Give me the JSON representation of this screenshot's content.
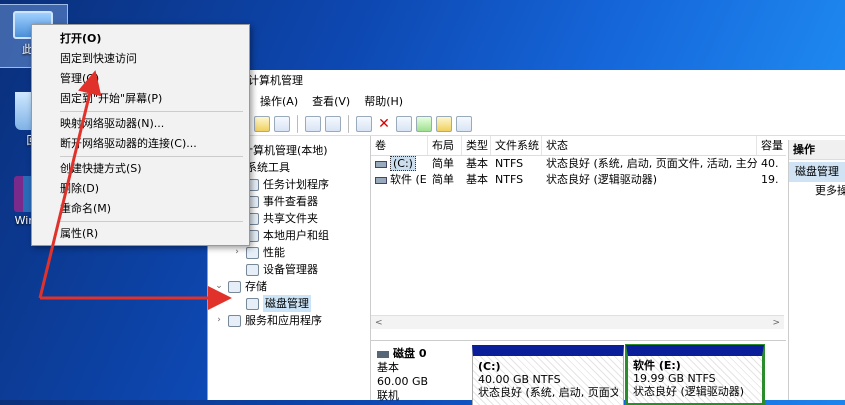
{
  "desktop": {
    "icons": [
      {
        "label": "此电",
        "icon": "this-pc-icon"
      },
      {
        "label": "回",
        "icon": "recycle-bin-icon"
      },
      {
        "label": "Win10",
        "icon": "winrar-icon"
      }
    ]
  },
  "context_menu": {
    "items": [
      "打开(O)",
      "固定到快速访问",
      "管理(G)",
      "固定到\"开始\"屏幕(P)",
      "映射网络驱动器(N)...",
      "断开网络驱动器的连接(C)...",
      "创建快捷方式(S)",
      "删除(D)",
      "重命名(M)",
      "属性(R)"
    ]
  },
  "window": {
    "title": "计算机管理",
    "menu": [
      "操作(A)",
      "查看(V)",
      "帮助(H)"
    ],
    "tree": [
      {
        "label": "计算机管理(本地)",
        "arrow": ""
      },
      {
        "label": "系统工具",
        "arrow": "v"
      },
      {
        "label": "任务计划程序",
        "arrow": ">"
      },
      {
        "label": "事件查看器",
        "arrow": ">"
      },
      {
        "label": "共享文件夹",
        "arrow": ">"
      },
      {
        "label": "本地用户和组",
        "arrow": ">"
      },
      {
        "label": "性能",
        "arrow": ">"
      },
      {
        "label": "设备管理器",
        "arrow": ""
      },
      {
        "label": "存储",
        "arrow": "v"
      },
      {
        "label": "磁盘管理",
        "arrow": ""
      },
      {
        "label": "服务和应用程序",
        "arrow": ">"
      }
    ],
    "columns": [
      "卷",
      "布局",
      "类型",
      "文件系统",
      "状态",
      "容量"
    ],
    "rows": [
      [
        "(C:)",
        "简单",
        "基本",
        "NTFS",
        "状态良好 (系统, 启动, 页面文件, 活动, 主分区)",
        "40."
      ],
      [
        "软件 (E:)",
        "简单",
        "基本",
        "NTFS",
        "状态良好 (逻辑驱动器)",
        "19."
      ]
    ],
    "disk": {
      "name": "磁盘 0",
      "type": "基本",
      "size": "60.00 GB",
      "status": "联机",
      "partitions": [
        {
          "name": "(C:)",
          "size": "40.00 GB NTFS",
          "status": "状态良好 (系统, 启动, 页面文件"
        },
        {
          "name": "软件 (E:)",
          "size": "19.99 GB NTFS",
          "status": "状态良好 (逻辑驱动器)"
        }
      ]
    },
    "actions": {
      "header": "操作",
      "selected": "磁盘管理",
      "more": "更多操"
    }
  },
  "colors": {
    "arrow": "#e0322b",
    "accent_partition": "#0a1e9a",
    "selected_partition": "#2a8c2a"
  }
}
